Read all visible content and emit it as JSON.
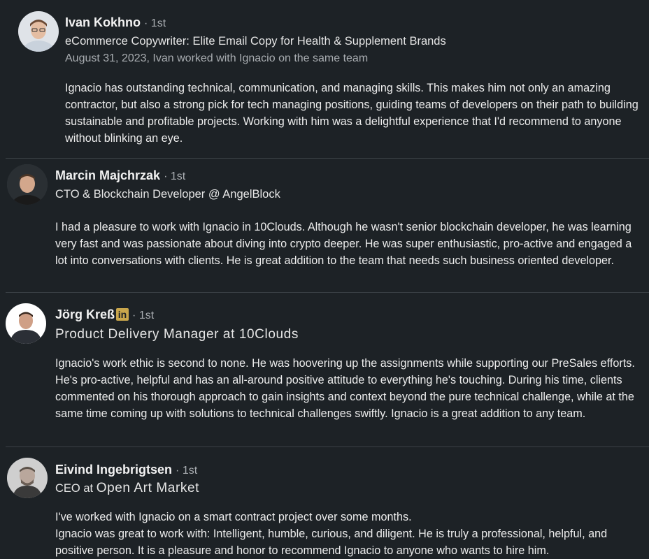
{
  "recommendations": [
    {
      "name": "Ivan Kokhno",
      "degree": "· 1st",
      "headline": "eCommerce Copywriter: Elite Email Copy for Health & Supplement Brands",
      "meta": "August 31, 2023, Ivan worked with Ignacio on the same team",
      "text": "Ignacio has outstanding technical, communication, and managing skills. This makes him not only an amazing contractor, but also a strong pick for tech managing positions, guiding teams of developers on their path to building sustainable and profitable projects. Working with him was a delightful experience that I'd recommend to anyone without blinking an eye."
    },
    {
      "name": "Marcin Majchrzak",
      "degree": "· 1st",
      "headline": "CTO & Blockchain Developer @ AngelBlock",
      "text": "I had a pleasure to work with Ignacio in 10Clouds. Although he wasn't senior blockchain developer, he was learning very fast and was passionate about diving into crypto deeper. He was super enthusiastic, pro-active and engaged a lot into conversations with clients. He is great addition to the team that needs such business oriented developer."
    },
    {
      "name": "Jörg Kreß",
      "badge": "in",
      "degree": "· 1st",
      "headline": "Product Delivery Manager at 10Clouds",
      "text": "Ignacio's work ethic is second to none. He was hoovering up the assignments while supporting our PreSales efforts. He's pro-active, helpful and has an all-around positive attitude to everything he's touching. During his time, clients commented on his thorough approach to gain insights and context beyond the pure technical challenge, while at the same time coming up with solutions to technical challenges swiftly. Ignacio is a great addition to any team."
    },
    {
      "name": "Eivind Ingebrigtsen",
      "degree": "· 1st",
      "headline_prefix": "CEO at",
      "headline_company": "Open Art Market",
      "text": "I've worked with Ignacio on a smart contract project over some months.\nIgnacio was great to work with: Intelligent, humble, curious, and diligent. He is truly a professional, helpful, and positive person. It is a pleasure and honor to recommend Ignacio to anyone who wants to hire him."
    }
  ],
  "icons": {
    "avatar": "avatar-photo",
    "badge": "linkedin-badge-icon"
  },
  "colors": {
    "background": "#1d2226",
    "text": "#e8e8e8",
    "muted": "#a9adb1",
    "badge": "#c9a64c"
  }
}
